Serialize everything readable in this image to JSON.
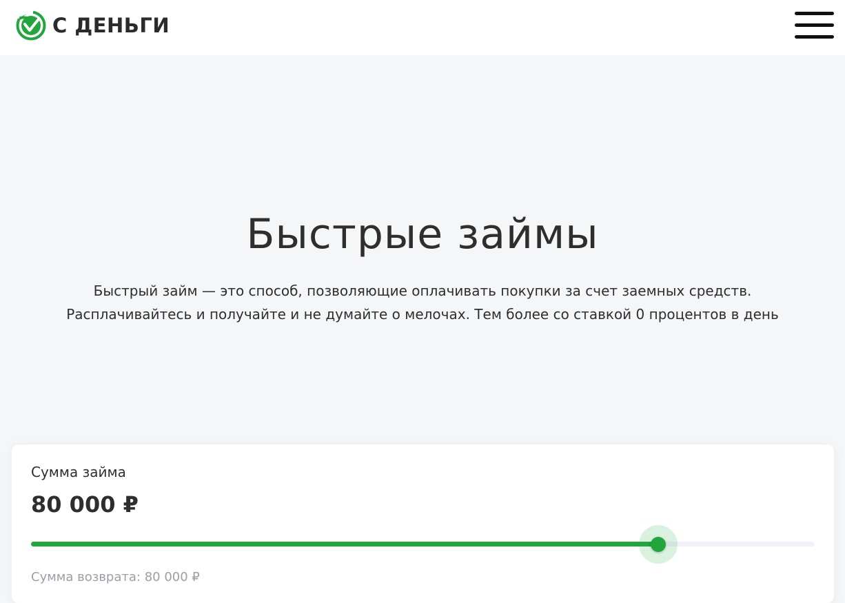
{
  "header": {
    "logo_text": "С ДЕНЬГИ",
    "logo_icon": "brand-check-circle-icon",
    "menu_icon": "hamburger-menu-icon"
  },
  "hero": {
    "title": "Быстрые займы",
    "description_line1": "Быстрый займ — это способ, позволяющие оплачивать покупки за счет заемных средств.",
    "description_line2": "Расплачивайтесь и получайте и не думайте о мелочах. Тем более со ставкой 0 процентов в день"
  },
  "calculator": {
    "amount_label": "Сумма займа",
    "amount_value": "80 000 ₽",
    "slider_fraction": 0.8,
    "return_label": "Сумма возврата: 80 000 ₽"
  },
  "colors": {
    "brand_green": "#22a53c",
    "page_background": "#f5f6f8",
    "text": "#2e2e2e",
    "muted_text": "#9a9ea6"
  }
}
